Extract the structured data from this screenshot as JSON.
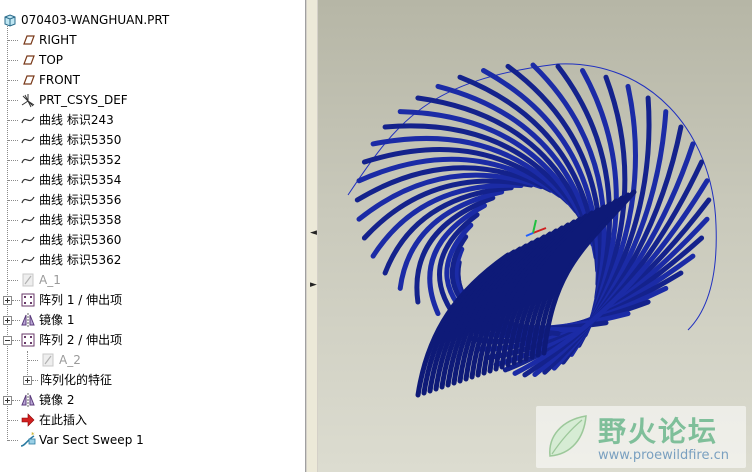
{
  "model_tree": {
    "root": {
      "label": "070403-WANGHUAN.PRT",
      "icon": "part-icon"
    },
    "items": [
      {
        "label": "RIGHT",
        "icon": "datum-plane-icon"
      },
      {
        "label": "TOP",
        "icon": "datum-plane-icon"
      },
      {
        "label": "FRONT",
        "icon": "datum-plane-icon"
      },
      {
        "label": "PRT_CSYS_DEF",
        "icon": "coordinate-system-icon"
      },
      {
        "label": "曲线 标识243",
        "icon": "curve-icon"
      },
      {
        "label": "曲线 标识5350",
        "icon": "curve-icon"
      },
      {
        "label": "曲线 标识5352",
        "icon": "curve-icon"
      },
      {
        "label": "曲线 标识5354",
        "icon": "curve-icon"
      },
      {
        "label": "曲线 标识5356",
        "icon": "curve-icon"
      },
      {
        "label": "曲线 标识5358",
        "icon": "curve-icon"
      },
      {
        "label": "曲线 标识5360",
        "icon": "curve-icon"
      },
      {
        "label": "曲线 标识5362",
        "icon": "curve-icon"
      },
      {
        "label": "A_1",
        "icon": "datum-axis-icon"
      },
      {
        "label": "阵列 1 / 伸出项",
        "icon": "pattern-icon"
      },
      {
        "label": "镜像 1",
        "icon": "mirror-icon"
      },
      {
        "label": "阵列 2 / 伸出项",
        "icon": "pattern-icon"
      },
      {
        "label": "A_2",
        "icon": "datum-axis-icon"
      },
      {
        "label": "阵列化的特征",
        "icon": "patterned-feature-icon"
      },
      {
        "label": "镜像 2",
        "icon": "mirror-icon"
      },
      {
        "label": "在此插入",
        "icon": "insert-here-arrow-icon"
      },
      {
        "label": "Var Sect Sweep 1",
        "icon": "var-sect-sweep-icon"
      }
    ]
  },
  "splitter": {
    "collapse_arrow": "◄",
    "expand_arrow": "►"
  },
  "watermark": {
    "title": "野火论坛",
    "url": "www.proewildfire.cn"
  },
  "colors": {
    "model_blue": "#1a2a9c",
    "background_top": "#b6b6a6",
    "background_bottom": "#dcdcd0"
  }
}
